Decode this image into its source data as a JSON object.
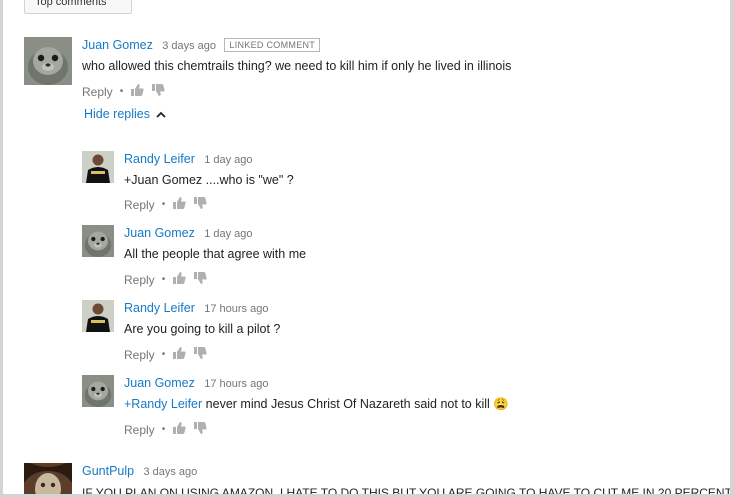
{
  "sort_button": {
    "label": "Top comments"
  },
  "top_comment": {
    "author": "Juan Gomez",
    "time": "3 days ago",
    "badge": "LINKED COMMENT",
    "text": "who allowed this chemtrails thing? we need to kill him if only he lived in illinois",
    "reply_label": "Reply",
    "hide_replies_label": "Hide replies"
  },
  "replies": [
    {
      "author": "Randy Leifer",
      "time": "1 day ago",
      "text": "+Juan Gomez ....who is \"we\" ?",
      "reply_label": "Reply"
    },
    {
      "author": "Juan Gomez",
      "time": "1 day ago",
      "text": "All the people that agree with me",
      "reply_label": "Reply"
    },
    {
      "author": "Randy Leifer",
      "time": "17 hours ago",
      "text": "Are you going to kill a pilot ?",
      "reply_label": "Reply"
    },
    {
      "author": "Juan Gomez",
      "time": "17 hours ago",
      "mention": "+Randy Leifer",
      "text": " never mind Jesus Christ Of Nazareth said not to kill",
      "emoji": "😩",
      "reply_label": "Reply"
    }
  ],
  "next_comment": {
    "author": "GuntPulp",
    "time": "3 days ago",
    "text_partial": "IF YOU PLAN ON USING AMAZON, I HATE TO DO THIS BUT YOU ARE GOING TO HAVE TO CUT ME IN 20 PERCENT"
  }
}
